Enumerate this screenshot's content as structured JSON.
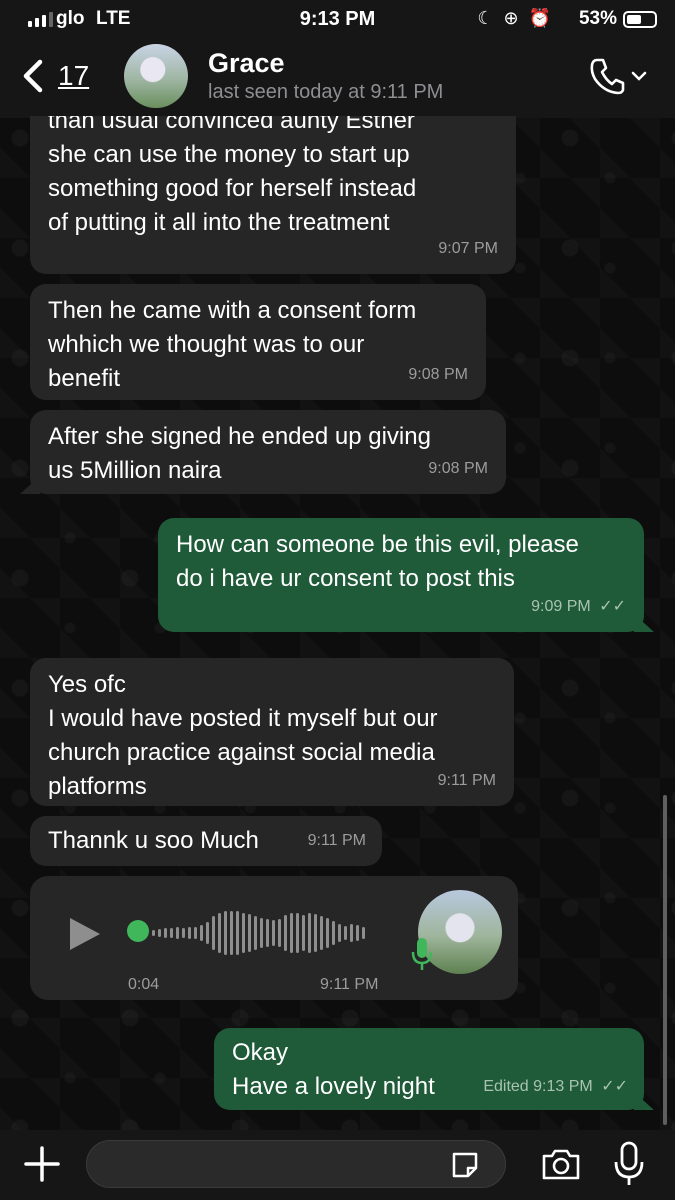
{
  "status_bar": {
    "carrier": "glo",
    "network": "LTE",
    "time": "9:13 PM",
    "battery_percent": "53%"
  },
  "header": {
    "back_count": "17",
    "contact_name": "Grace",
    "last_seen": "last seen today at 9:11 PM"
  },
  "messages": [
    {
      "direction": "incoming",
      "text": "than usual convinced aunty Esther\nshe can use the money to start up\nsomething good for herself instead\nof putting it all into the treatment",
      "time": "9:07 PM"
    },
    {
      "direction": "incoming",
      "text": "Then he came with a consent form\nwhhich we thought was to our\nbenefit",
      "time": "9:08 PM"
    },
    {
      "direction": "incoming",
      "text": "After she signed he ended up giving\nus 5Million naira",
      "time": "9:08 PM"
    },
    {
      "direction": "outgoing",
      "text": "How can someone be this evil, please\ndo i have ur consent to post this",
      "time": "9:09 PM"
    },
    {
      "direction": "incoming",
      "text": "Yes ofc\nI would have posted it myself but our\nchurch practice against social media\nplatforms",
      "time": "9:11 PM"
    },
    {
      "direction": "incoming",
      "text": "Thannk u soo Much",
      "time": "9:11 PM"
    },
    {
      "direction": "outgoing",
      "text": "Okay\nHave a lovely night",
      "time": "Edited 9:13 PM"
    }
  ],
  "voice_note": {
    "duration": "0:04",
    "time": "9:11 PM"
  },
  "colors": {
    "incoming_bubble": "#262626",
    "outgoing_bubble": "#1f5a39",
    "accent_green": "#3fb75a"
  }
}
